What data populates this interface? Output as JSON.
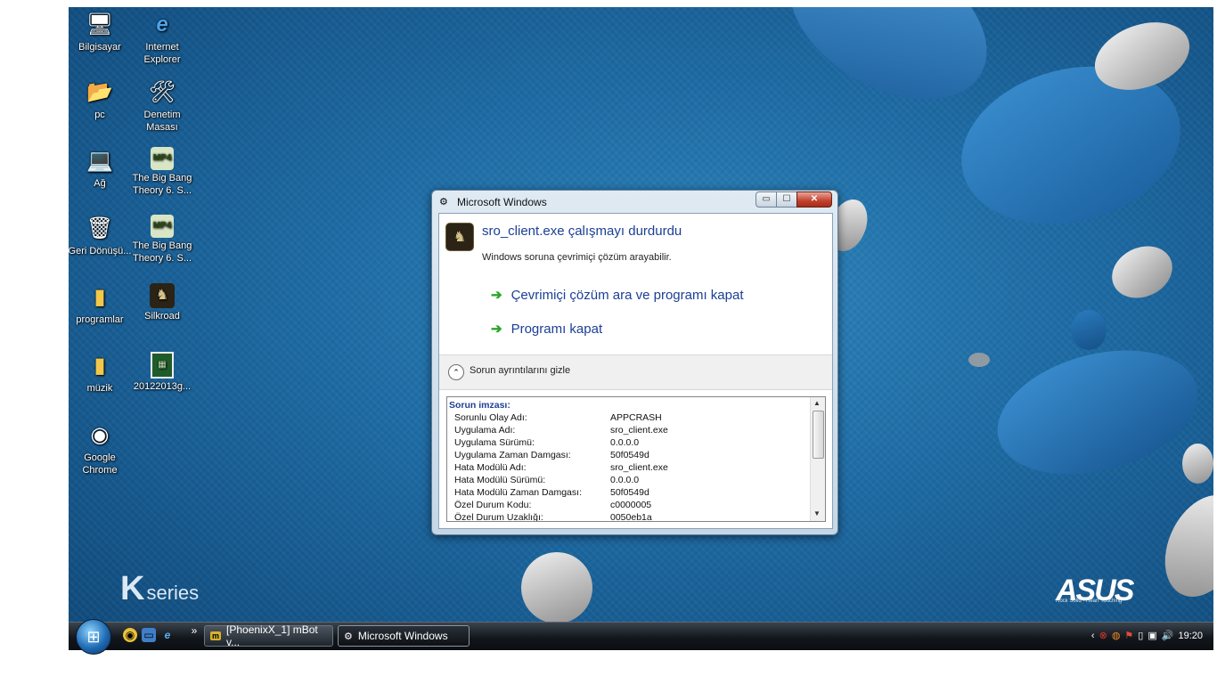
{
  "desktop": {
    "icons_col1": [
      {
        "label": "Bilgisayar",
        "icon": "computer-icon"
      },
      {
        "label": "pc",
        "icon": "user-folder-icon"
      },
      {
        "label": "Ağ",
        "icon": "network-icon"
      },
      {
        "label": "Geri Dönüşü...",
        "icon": "recycle-bin-icon"
      },
      {
        "label": "programlar",
        "icon": "folder-icon"
      },
      {
        "label": "müzik",
        "icon": "folder-icon"
      },
      {
        "label": "Google Chrome",
        "icon": "chrome-icon"
      }
    ],
    "icons_col2": [
      {
        "label": "Internet Explorer",
        "icon": "ie-icon"
      },
      {
        "label": "Denetim Masası",
        "icon": "control-panel-icon"
      },
      {
        "label": "The Big Bang Theory 6. S...",
        "icon": "mp4-icon"
      },
      {
        "label": "The Big Bang Theory 6. S...",
        "icon": "mp4-icon"
      },
      {
        "label": "Silkroad",
        "icon": "silkroad-icon"
      },
      {
        "label": "20122013g...",
        "icon": "spreadsheet-icon"
      }
    ],
    "brand_left": "K",
    "brand_left_sub": "series",
    "brand_right": "ASUS",
    "brand_right_sub": "Rock Solid · Heart Touching"
  },
  "dialog": {
    "title": "Microsoft Windows",
    "heading": "sro_client.exe çalışmayı durdurdu",
    "subtext": "Windows soruna çevrimiçi çözüm arayabilir.",
    "commands": [
      "Çevrimiçi çözüm ara ve programı kapat",
      "Programı kapat"
    ],
    "details_toggle": "Sorun ayrıntılarını gizle",
    "details_heading": "Sorun imzası:",
    "details": [
      {
        "key": "Sorunlu Olay Adı:",
        "value": "APPCRASH"
      },
      {
        "key": "Uygulama Adı:",
        "value": "sro_client.exe"
      },
      {
        "key": "Uygulama Sürümü:",
        "value": "0.0.0.0"
      },
      {
        "key": "Uygulama Zaman Damgası:",
        "value": "50f0549d"
      },
      {
        "key": "Hata Modülü Adı:",
        "value": "sro_client.exe"
      },
      {
        "key": "Hata Modülü Sürümü:",
        "value": "0.0.0.0"
      },
      {
        "key": "Hata Modülü Zaman Damgası:",
        "value": "50f0549d"
      },
      {
        "key": "Özel Durum Kodu:",
        "value": "c0000005"
      },
      {
        "key": "Özel Durum Uzaklığı:",
        "value": "0050eb1a"
      }
    ]
  },
  "taskbar": {
    "overflow": "»",
    "buttons": [
      {
        "label": "[PhoenixX_1] mBot v...",
        "icon": "mbot-icon"
      },
      {
        "label": "Microsoft Windows",
        "icon": "windows-error-icon"
      }
    ],
    "clock": "19:20"
  }
}
